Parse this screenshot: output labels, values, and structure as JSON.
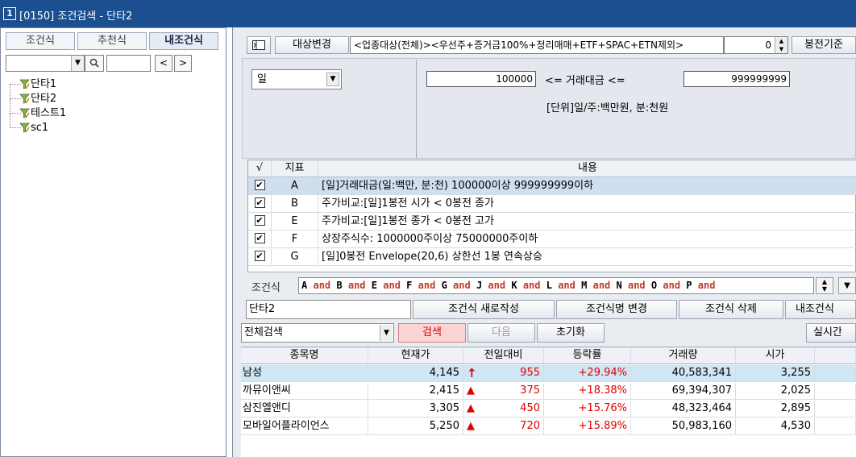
{
  "window": {
    "number": "1",
    "title": "[0150] 조건검색 - 단타2"
  },
  "left": {
    "tabs": [
      {
        "label": "조건식",
        "active": false
      },
      {
        "label": "추천식",
        "active": false
      },
      {
        "label": "내조건식",
        "active": true
      }
    ],
    "search_icon": "magnifier-icon",
    "prev_label": "<",
    "next_label": ">",
    "tree": [
      "단타1",
      "단타2",
      "테스트1",
      "sc1"
    ]
  },
  "toolbar": {
    "target_change": "대상변경",
    "target_text": "<업종대상(전체)><우선주+증거금100%+정리매매+ETF+SPAC+ETN제외>",
    "bong_value": "0",
    "bong_label": "봉전기준"
  },
  "condition_editor": {
    "period": "일",
    "min_value": "100000",
    "relation": "<= 거래대금 <=",
    "max_value": "999999999",
    "unit_note": "[단위]일/주:백만원, 분:천원"
  },
  "indicators": {
    "headers": [
      "√",
      "지표",
      "내용"
    ],
    "rows": [
      {
        "checked": true,
        "id": "A",
        "content": "[일]거래대금(일:백만, 분:천) 100000이상 999999999이하",
        "selected": true
      },
      {
        "checked": true,
        "id": "B",
        "content": "주가비교:[일]1봉전 시가 < 0봉전 종가",
        "selected": false
      },
      {
        "checked": true,
        "id": "E",
        "content": "주가비교:[일]1봉전 종가 < 0봉전 고가",
        "selected": false
      },
      {
        "checked": true,
        "id": "F",
        "content": "상장주식수: 1000000주이상 75000000주이하",
        "selected": false
      },
      {
        "checked": true,
        "id": "G",
        "content": "[일]0봉전 Envelope(20,6) 상한선 1봉 연속상승",
        "selected": false
      }
    ]
  },
  "expression": {
    "label": "조건식",
    "terms": [
      "A",
      "and",
      "B",
      "and",
      "E",
      "and",
      "F",
      "and",
      "G",
      "and",
      "J",
      "and",
      "K",
      "and",
      "L",
      "and",
      "M",
      "and",
      "N",
      "and",
      "O",
      "and",
      "P",
      "and"
    ]
  },
  "actions": {
    "name_value": "단타2",
    "new_label": "조건식 새로작성",
    "rename_label": "조건식명 변경",
    "delete_label": "조건식 삭제",
    "my_label": "내조건식"
  },
  "search": {
    "scope": "전체검색",
    "search_label": "검색",
    "next_label": "다음",
    "reset_label": "초기화",
    "realtime_label": "실시간"
  },
  "results": {
    "headers": [
      "종목명",
      "현재가",
      "전일대비",
      "등락률",
      "거래량",
      "시가"
    ],
    "rows": [
      {
        "name": "남성",
        "price": "4,145",
        "dir": "↑",
        "change": "955",
        "rate": "+29.94%",
        "volume": "40,583,341",
        "open": "3,255",
        "selected": true
      },
      {
        "name": "까뮤이앤씨",
        "price": "2,415",
        "dir": "▲",
        "change": "375",
        "rate": "+18.38%",
        "volume": "69,394,307",
        "open": "2,025",
        "selected": false
      },
      {
        "name": "삼진엘앤디",
        "price": "3,305",
        "dir": "▲",
        "change": "450",
        "rate": "+15.76%",
        "volume": "48,323,464",
        "open": "2,895",
        "selected": false
      },
      {
        "name": "모바일어플라이언스",
        "price": "5,250",
        "dir": "▲",
        "change": "720",
        "rate": "+15.89%",
        "volume": "50,983,160",
        "open": "4,530",
        "selected": false
      }
    ]
  },
  "colors": {
    "titlebar": "#1b4f8f",
    "up": "#e00000",
    "selected_row": "#cfe6f4"
  }
}
